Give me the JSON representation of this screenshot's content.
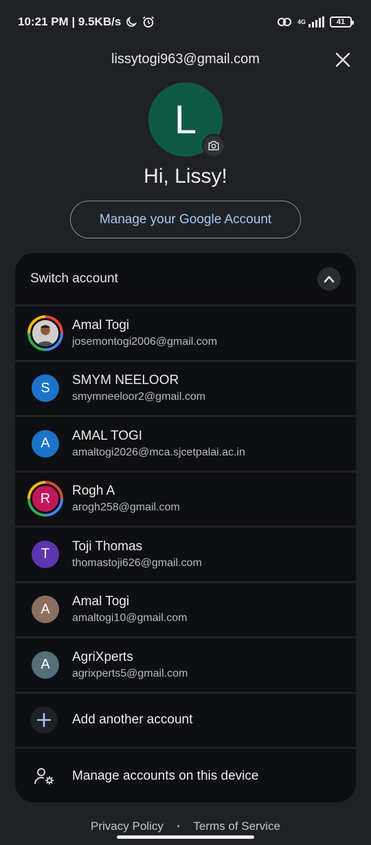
{
  "status_bar": {
    "time_speed": "10:21 PM | 9.5KB/s",
    "network": "4G",
    "battery": "41"
  },
  "header": {
    "email": "lissytogi963@gmail.com"
  },
  "profile": {
    "initial": "L",
    "greeting": "Hi, Lissy!",
    "manage_label": "Manage your Google Account",
    "avatar_color": "#0f5a45"
  },
  "switch": {
    "label": "Switch account"
  },
  "accounts": [
    {
      "name": "Amal Togi",
      "email": "josemontogi2006@gmail.com",
      "initial": "",
      "color": "#c9c7c2"
    },
    {
      "name": "SMYM NEELOOR",
      "email": "smymneeloor2@gmail.com",
      "initial": "S",
      "color": "#1a73c9"
    },
    {
      "name": "AMAL TOGI",
      "email": "amaltogi2026@mca.sjcetpalai.ac.in",
      "initial": "A",
      "color": "#1a73c9"
    },
    {
      "name": "Rogh A",
      "email": "arogh258@gmail.com",
      "initial": "R",
      "color": "#c2185b"
    },
    {
      "name": "Toji Thomas",
      "email": "thomastoji626@gmail.com",
      "initial": "T",
      "color": "#5e35b1"
    },
    {
      "name": "Amal Togi",
      "email": "amaltogi10@gmail.com",
      "initial": "A",
      "color": "#8d6e63"
    },
    {
      "name": "AgriXperts",
      "email": "agrixperts5@gmail.com",
      "initial": "A",
      "color": "#546e7a"
    }
  ],
  "actions": {
    "add_account": "Add another account",
    "manage_device": "Manage accounts on this device"
  },
  "footer": {
    "privacy": "Privacy Policy",
    "separator": "•",
    "terms": "Terms of Service"
  }
}
